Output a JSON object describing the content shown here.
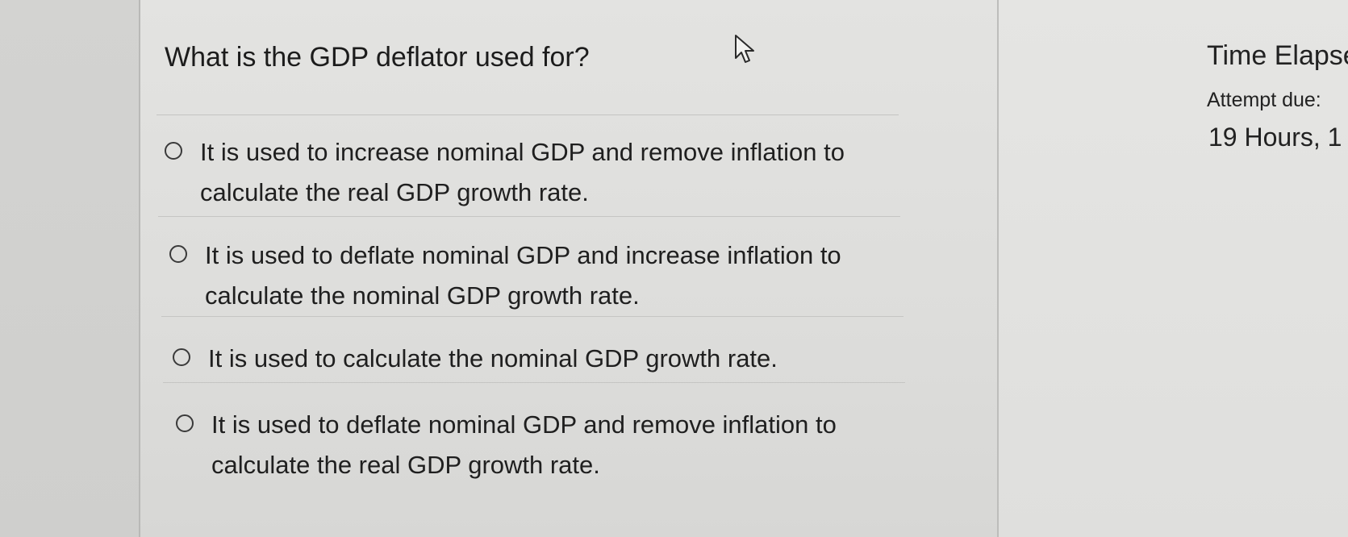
{
  "question": {
    "text": "What is the GDP deflator used for?"
  },
  "options": [
    {
      "line1": "It is used to increase nominal GDP and remove inflation to",
      "line2": "calculate the real GDP growth rate."
    },
    {
      "line1": "It is used to deflate nominal GDP and increase inflation to",
      "line2": "calculate the nominal GDP growth rate."
    },
    {
      "line1": "It is used to calculate the nominal GDP growth rate.",
      "line2": ""
    },
    {
      "line1": "It is used to deflate nominal GDP and remove inflation to",
      "line2": "calculate the real GDP growth rate."
    }
  ],
  "timer": {
    "title": "Time Elapse",
    "attempt_due": "Attempt due: ",
    "remaining": "19 Hours, 1"
  },
  "icons": {
    "cursor": "mouse-pointer-icon",
    "radio": "radio-unselected-icon"
  },
  "colors": {
    "page_background": "#d9d9d7",
    "text": "#1f1f1f",
    "divider": "#c5c5c3"
  }
}
